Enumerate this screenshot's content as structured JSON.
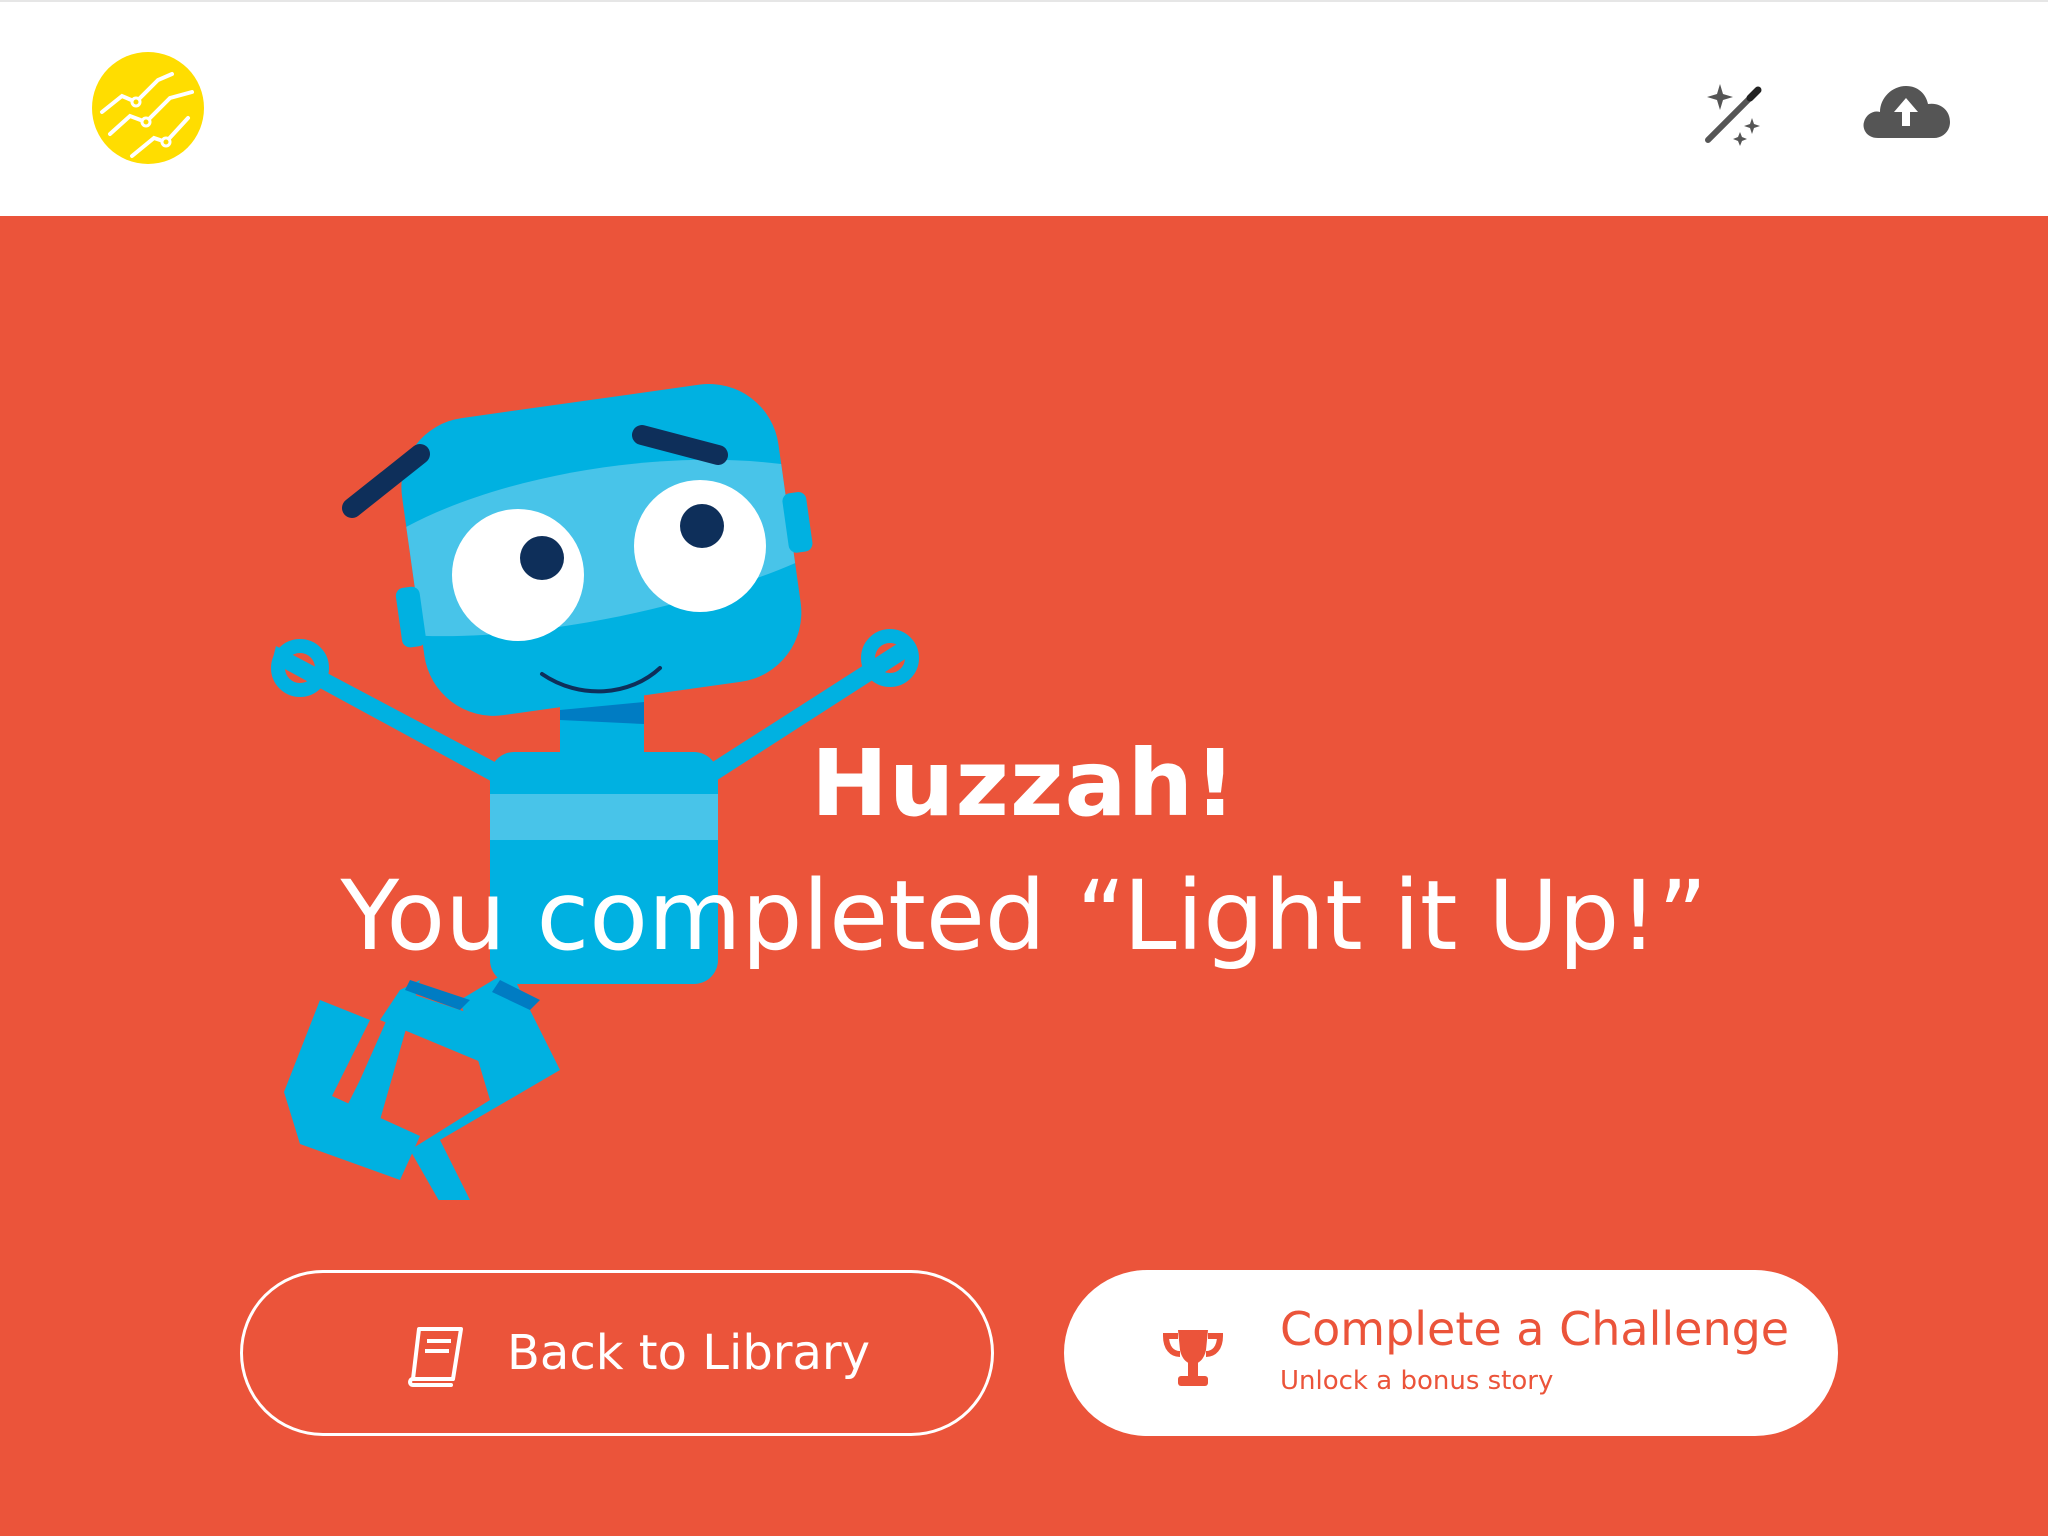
{
  "header": {
    "logo_icon": "yellow-circuit-logo",
    "magic_icon": "magic-wand-icon",
    "upload_icon": "cloud-upload-icon"
  },
  "completion": {
    "headline": "Huzzah!",
    "message": "You completed “Light it Up!”"
  },
  "actions": {
    "library": {
      "label": "Back to Library",
      "icon": "book-icon"
    },
    "challenge": {
      "title": "Complete a Challenge",
      "subtitle": "Unlock a bonus story",
      "icon": "trophy-icon"
    }
  },
  "colors": {
    "background": "#EB543A",
    "header": "#FFFFFF",
    "logo": "#FFDD00",
    "robot": "#00B1E1",
    "icon_gray": "#555555"
  }
}
